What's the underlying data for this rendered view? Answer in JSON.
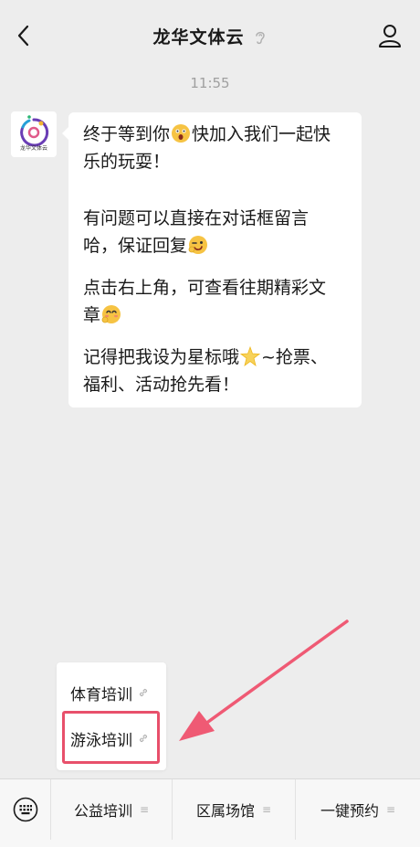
{
  "header": {
    "title": "龙华文体云",
    "back_icon": "chevron-left-icon",
    "profile_icon": "person-icon"
  },
  "chat": {
    "time": "11:55",
    "avatar_label": "龙华文体云",
    "message": {
      "line1": "终于等到你",
      "line1b": "快加入我们一起快",
      "line2": "乐的玩耍！",
      "line3": "有问题可以直接在对话框留言",
      "line4": "哈，保证回复",
      "line5": "点击右上角，可查看往期精彩文",
      "line6": "章",
      "line7": "记得把我设为星标哦",
      "line7b": "~抢票、",
      "line8": "福利、活动抢先看！"
    }
  },
  "submenu": {
    "items": [
      {
        "label": "体育培训"
      },
      {
        "label": "游泳培训"
      }
    ]
  },
  "bottom_menu": {
    "tabs": [
      {
        "label": "公益培训"
      },
      {
        "label": "区属场馆"
      },
      {
        "label": "一键预约"
      }
    ]
  },
  "colors": {
    "background": "#ededed",
    "highlight": "#e8506b",
    "bubble": "#ffffff"
  }
}
